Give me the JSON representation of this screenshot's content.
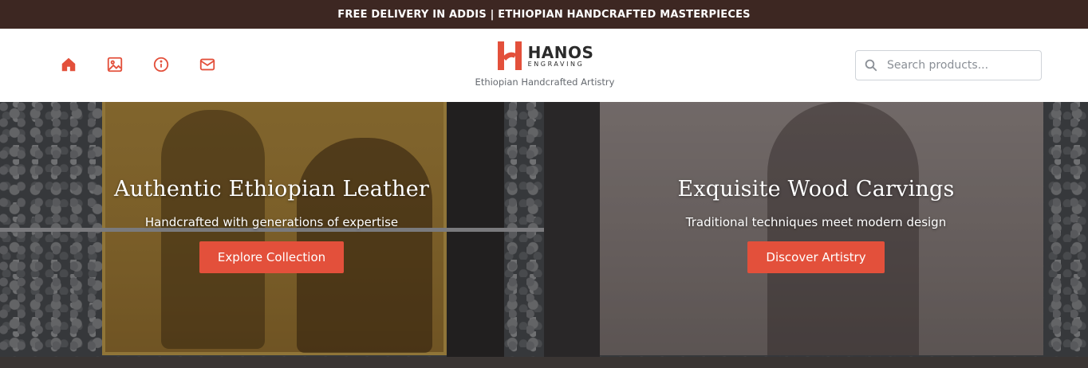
{
  "announcement": "FREE DELIVERY IN ADDIS | ETHIOPIAN HANDCRAFTED MASTERPIECES",
  "nav": {
    "items": [
      {
        "icon": "home-icon",
        "color": "#e3503b"
      },
      {
        "icon": "gallery-icon",
        "color": "#e3503b"
      },
      {
        "icon": "info-icon",
        "color": "#e3503b"
      },
      {
        "icon": "mail-icon",
        "color": "#e3503b"
      }
    ]
  },
  "logo": {
    "name": "HANOS",
    "subtitle": "ENGRAVING",
    "tagline": "Ethiopian Handcrafted Artistry"
  },
  "search": {
    "placeholder": "Search products..."
  },
  "hero": {
    "slides": [
      {
        "title": "Authentic Ethiopian Leather",
        "subtitle": "Handcrafted with generations of expertise",
        "button": "Explore Collection"
      },
      {
        "title": "Exquisite Wood Carvings",
        "subtitle": "Traditional techniques meet modern design",
        "button": "Discover Artistry"
      }
    ]
  },
  "colors": {
    "accent": "#e3503b",
    "topbar": "#3d2722"
  }
}
